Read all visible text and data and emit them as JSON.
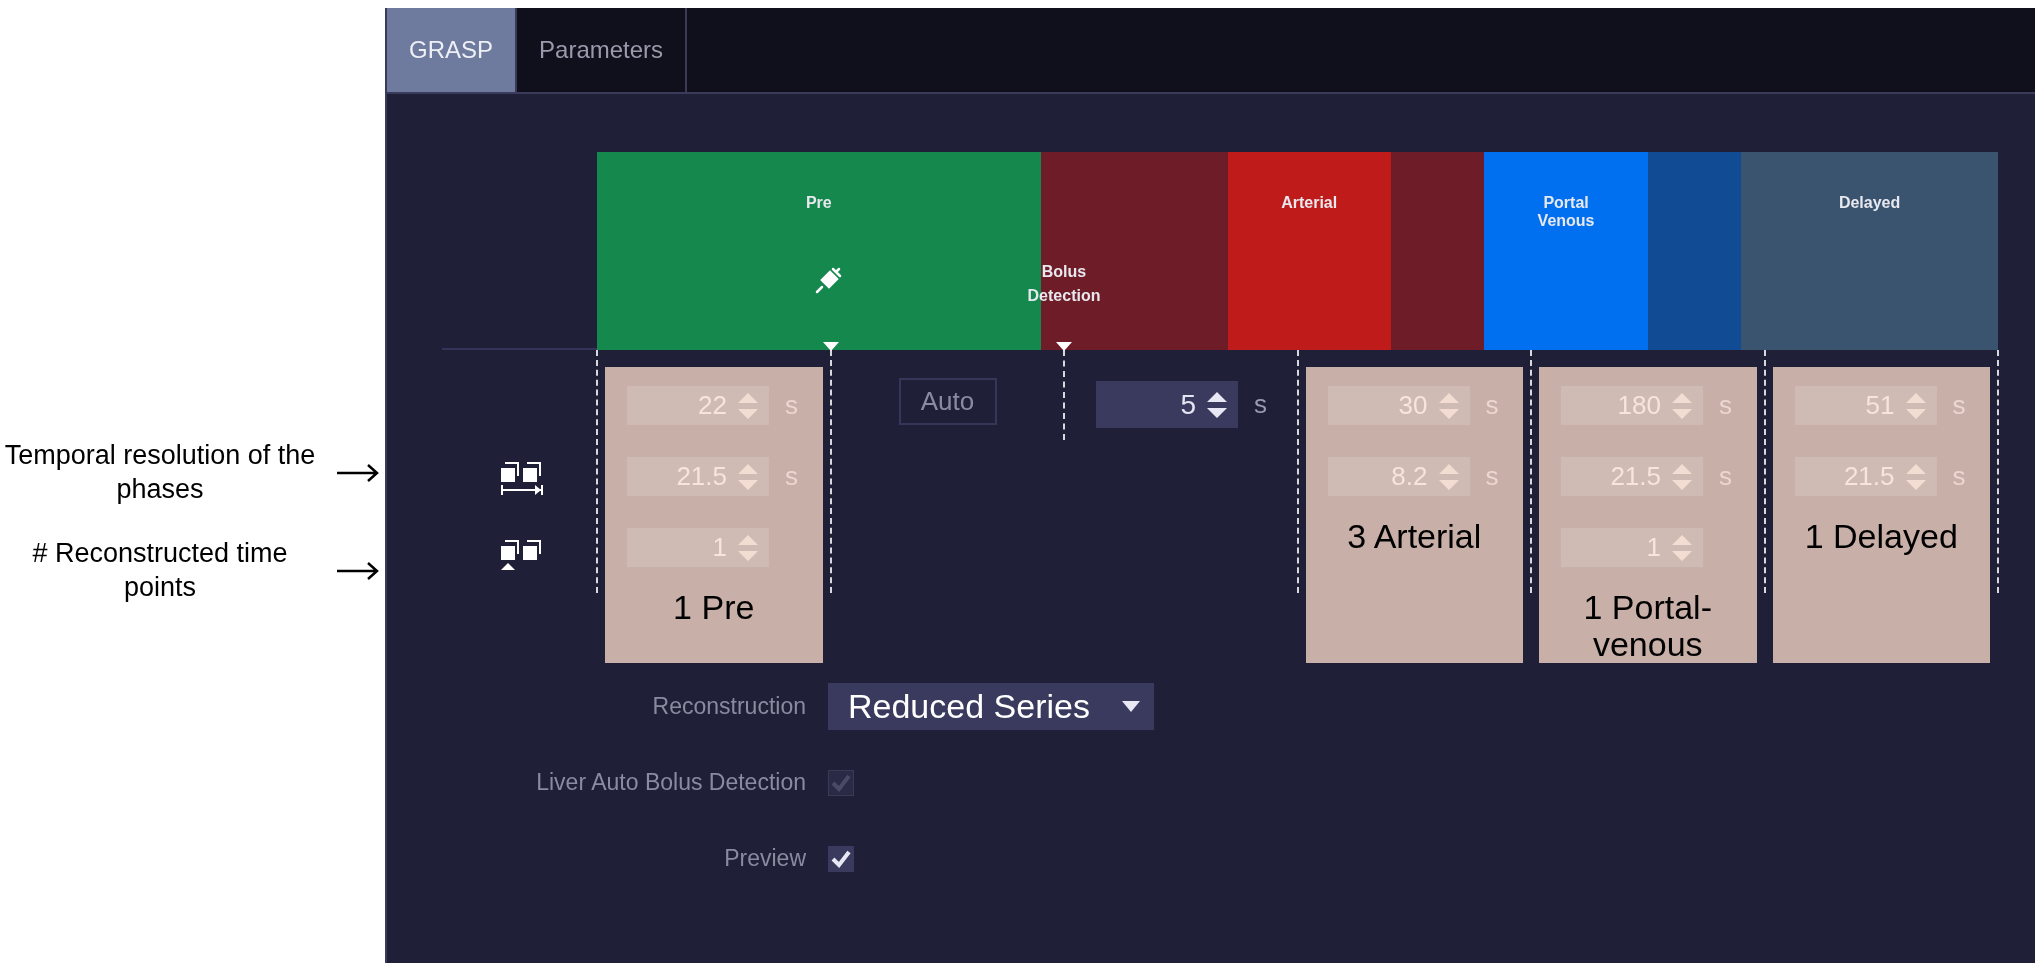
{
  "annotations": [
    {
      "text": "Temporal resolution of the phases"
    },
    {
      "text": "# Reconstructed time points"
    }
  ],
  "tabs": [
    {
      "label": "GRASP",
      "selected": true
    },
    {
      "label": "Parameters",
      "selected": false
    }
  ],
  "timeline": {
    "segments": [
      {
        "label": "Pre",
        "color": "#15884e"
      },
      {
        "color": "#6e1c28"
      },
      {
        "label": "Arterial",
        "color": "#c01b1b"
      },
      {
        "color": "#6e1c28"
      },
      {
        "label": "Portal Venous",
        "color": "#0070f0"
      },
      {
        "color": "#114b93"
      },
      {
        "label": "Delayed",
        "color": "#3a5470"
      }
    ],
    "bolus_label": "Bolus Detection"
  },
  "auto_button": "Auto",
  "delay_field": {
    "value": "5",
    "unit": "s"
  },
  "phases": [
    {
      "annotation": "1 Pre",
      "fields": [
        {
          "value": "22",
          "unit": "s"
        },
        {
          "value": "21.5",
          "unit": "s"
        },
        {
          "value": "1"
        }
      ]
    },
    {
      "annotation": "3 Arterial",
      "fields": [
        {
          "value": "30",
          "unit": "s"
        },
        {
          "value": "8.2",
          "unit": "s"
        }
      ]
    },
    {
      "annotation": "1 Portal-venous",
      "fields": [
        {
          "value": "180",
          "unit": "s"
        },
        {
          "value": "21.5",
          "unit": "s"
        },
        {
          "value": "1"
        }
      ]
    },
    {
      "annotation": "1 Delayed",
      "fields": [
        {
          "value": "51",
          "unit": "s"
        },
        {
          "value": "21.5",
          "unit": "s"
        }
      ]
    }
  ],
  "settings": [
    {
      "kind": "dropdown",
      "label": "Reconstruction",
      "value": "Reduced Series"
    },
    {
      "kind": "checkbox",
      "label": "Liver Auto Bolus Detection",
      "checked": true,
      "disabled": true
    },
    {
      "kind": "checkbox",
      "label": "Preview",
      "checked": true,
      "disabled": false
    }
  ]
}
